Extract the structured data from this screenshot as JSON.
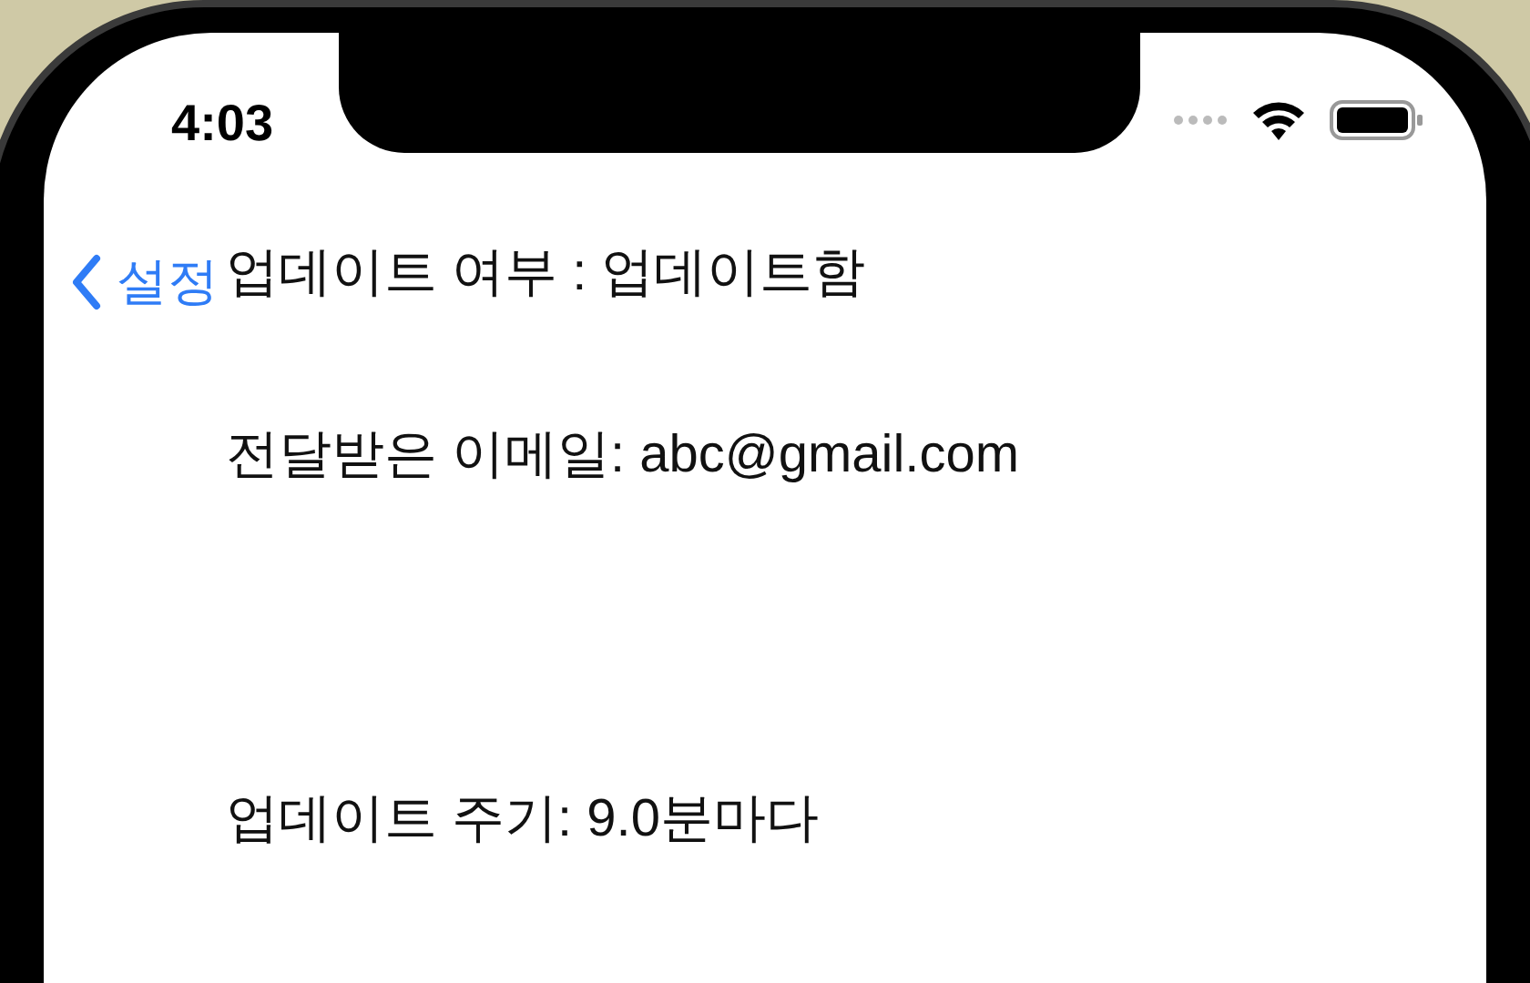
{
  "status_bar": {
    "time": "4:03"
  },
  "navigation": {
    "back_label": "설정"
  },
  "lines": [
    "업데이트 여부 : 업데이트함",
    "전달받은 이메일: abc@gmail.com",
    "업데이트 주기: 9.0분마다"
  ]
}
